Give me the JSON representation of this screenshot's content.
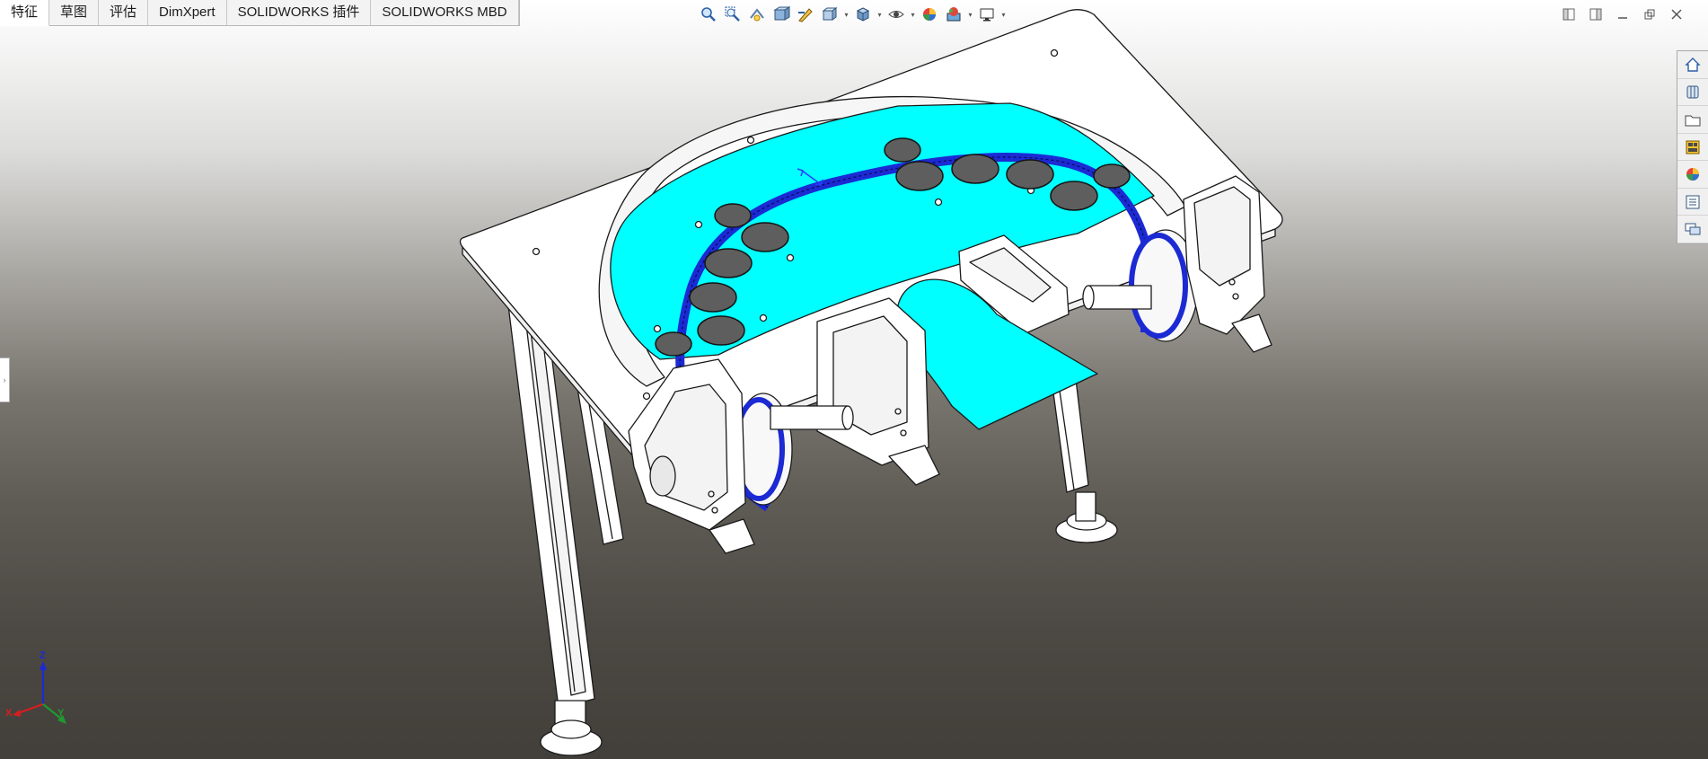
{
  "tabs": [
    {
      "label": "特征",
      "active": true
    },
    {
      "label": "草图"
    },
    {
      "label": "评估"
    },
    {
      "label": "DimXpert"
    },
    {
      "label": "SOLIDWORKS 插件"
    },
    {
      "label": "SOLIDWORKS MBD"
    }
  ],
  "heads_up_toolbar": [
    "zoom-to-fit-icon",
    "zoom-to-area-icon",
    "previous-view-icon",
    "section-view-icon",
    "dynamic-annotation-icon",
    "view-orientation-icon",
    "display-style-icon",
    "hide-show-items-icon",
    "edit-appearance-icon",
    "apply-scene-icon",
    "view-settings-icon"
  ],
  "task_pane": [
    "solidworks-resources-icon",
    "design-library-icon",
    "file-explorer-icon",
    "view-palette-icon",
    "appearances-scenes-icon",
    "custom-properties-icon",
    "forum-icon"
  ],
  "triad": {
    "x": "X",
    "y": "Y",
    "z": "Z"
  },
  "colors": {
    "plate": "#00ffff",
    "chain": "#1c2ad4",
    "disc": "#5e5e5e",
    "frame": "#ffffff",
    "edge": "#1a1a1a"
  }
}
